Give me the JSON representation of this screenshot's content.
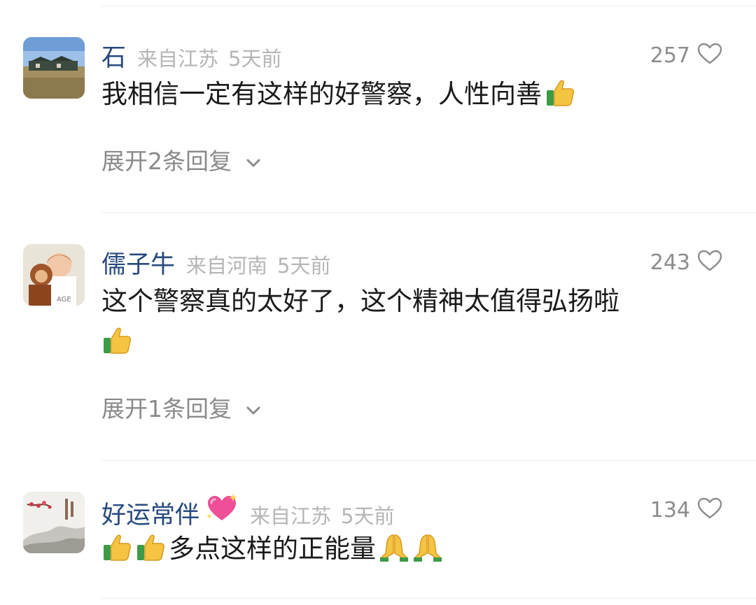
{
  "comments": [
    {
      "username": "石",
      "location": "来自江苏",
      "time": "5天前",
      "likes": "257",
      "text": "我相信一定有这样的好警察，人性向善",
      "emojis_after": [
        "thumbs-up"
      ],
      "expand_label": "展开2条回复",
      "avatar": "landscape-building-avatar"
    },
    {
      "username": "儒子牛",
      "location": "来自河南",
      "time": "5天前",
      "likes": "243",
      "text": "这个警察真的太好了，这个精神太值得弘扬啦",
      "emojis_after": [
        "thumbs-up"
      ],
      "expand_label": "展开1条回复",
      "avatar": "person-with-monkey-avatar"
    },
    {
      "username": "好运常伴",
      "username_emoji": "sparkling-heart",
      "location": "来自江苏",
      "time": "5天前",
      "likes": "134",
      "emojis_before": [
        "thumbs-up",
        "thumbs-up"
      ],
      "text": "多点这样的正能量",
      "emojis_after": [
        "folded-hands",
        "folded-hands"
      ],
      "avatar": "plum-blossom-painting-avatar"
    }
  ],
  "colors": {
    "username": "#274a7e",
    "meta": "#b6b6b6",
    "text": "#1a1a1a",
    "like_count": "#8d8d8d",
    "expand": "#8a8a8a",
    "divider": "#ececec"
  }
}
